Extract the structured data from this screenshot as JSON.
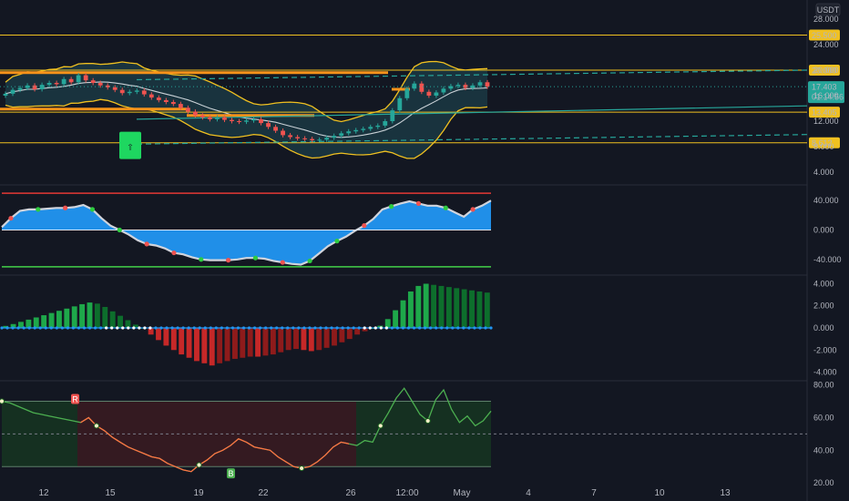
{
  "chart_data": [
    {
      "type": "candlestick",
      "pane": "price",
      "currency": "USDT",
      "y_ticks": [
        "28.000",
        "24.000",
        "20.000",
        "16.000",
        "12.000",
        "8.000",
        "4.000"
      ],
      "ylim": [
        2.0,
        31.0
      ],
      "price_levels": [
        {
          "value": 25.5,
          "label": "25.500",
          "color": "#f0c020"
        },
        {
          "value": 20.0,
          "label": "20.000",
          "color": "#f0c020"
        },
        {
          "value": 13.405,
          "label": "13.405",
          "color": "#f0c020"
        },
        {
          "value": 8.612,
          "label": "8.612",
          "color": "#f0c020"
        }
      ],
      "current_price": {
        "value": 17.403,
        "label": "17.403",
        "countdown": "01:14:56",
        "color": "#26a69a"
      },
      "signal_arrow": {
        "symbol": "⇧",
        "color": "#1ed760"
      },
      "closes": [
        16.3,
        16.9,
        17.2,
        17.6,
        17.0,
        17.7,
        18.0,
        17.8,
        18.6,
        18.1,
        19.2,
        18.4,
        18.0,
        17.6,
        17.3,
        16.9,
        16.4,
        16.6,
        16.8,
        16.2,
        15.7,
        15.3,
        15.0,
        14.7,
        14.1,
        13.5,
        12.9,
        12.6,
        12.3,
        12.6,
        12.2,
        12.0,
        11.9,
        12.1,
        12.3,
        11.7,
        11.1,
        10.5,
        9.8,
        9.5,
        9.3,
        9.2,
        9.0,
        9.1,
        9.4,
        9.7,
        10.1,
        10.4,
        10.6,
        10.8,
        11.1,
        11.3,
        12.0,
        13.7,
        15.6,
        17.1,
        17.9,
        16.6,
        16.0,
        16.5,
        17.1,
        17.5,
        17.7,
        17.2,
        17.6,
        18.1,
        17.4
      ]
    },
    {
      "type": "area",
      "pane": "oscillator",
      "y_ticks": [
        "40.000",
        "0.000",
        "-40.000"
      ],
      "ylim": [
        -60,
        60
      ],
      "upper_line": 50,
      "lower_line": -50,
      "values": [
        4,
        16,
        26,
        28,
        28,
        29,
        30,
        30,
        31,
        34,
        28,
        16,
        6,
        0,
        -6,
        -14,
        -19,
        -21,
        -25,
        -31,
        -33,
        -37,
        -40,
        -41,
        -41,
        -41,
        -40,
        -38,
        -38,
        -39,
        -42,
        -44,
        -46,
        -47,
        -42,
        -32,
        -22,
        -15,
        -9,
        -1,
        6,
        15,
        28,
        32,
        36,
        39,
        36,
        33,
        33,
        30,
        24,
        18,
        28,
        33,
        40
      ]
    },
    {
      "type": "bar",
      "pane": "momentum",
      "y_ticks": [
        "4.000",
        "2.000",
        "0.000",
        "-2.000",
        "-4.000"
      ],
      "ylim": [
        -4.7,
        4.7
      ],
      "values": [
        0.18,
        0.35,
        0.55,
        0.75,
        0.95,
        1.15,
        1.35,
        1.55,
        1.75,
        1.95,
        2.15,
        2.3,
        2.2,
        1.9,
        1.5,
        1.1,
        0.7,
        0.3,
        0.0,
        -0.6,
        -1.1,
        -1.6,
        -2.0,
        -2.4,
        -2.7,
        -3.0,
        -3.2,
        -3.4,
        -3.2,
        -3.0,
        -2.8,
        -2.7,
        -2.6,
        -2.6,
        -2.5,
        -2.4,
        -2.2,
        -2.0,
        -1.9,
        -2.0,
        -2.1,
        -2.0,
        -1.8,
        -1.6,
        -1.3,
        -1.0,
        -0.6,
        -0.3,
        0.0,
        0.2,
        0.8,
        1.6,
        2.5,
        3.3,
        3.8,
        4.0,
        3.9,
        3.8,
        3.7,
        3.6,
        3.5,
        3.4,
        3.3,
        3.2
      ]
    },
    {
      "type": "line",
      "pane": "rsi",
      "y_ticks": [
        "80.00",
        "60.00",
        "40.00",
        "20.00"
      ],
      "ylim": [
        19,
        82
      ],
      "upper_band": 70,
      "lower_band": 30,
      "mid_line": 50,
      "values": [
        70,
        69,
        67,
        65,
        63,
        62,
        61,
        60,
        59,
        58,
        57,
        60,
        55,
        52,
        48,
        45,
        42,
        40,
        38,
        36,
        35,
        32,
        30,
        28,
        27,
        31,
        34,
        38,
        40,
        43,
        47,
        45,
        42,
        41,
        40,
        36,
        33,
        30,
        29,
        30,
        33,
        37,
        42,
        45,
        44,
        43,
        46,
        45,
        55,
        63,
        72,
        78,
        70,
        62,
        58,
        71,
        77,
        65,
        57,
        61,
        55,
        58,
        64
      ],
      "marker_labels": [
        "R",
        "B"
      ]
    }
  ],
  "x_axis": {
    "ticks": [
      "12",
      "15",
      "19",
      "22",
      "26",
      "12:00",
      "May",
      "4",
      "7",
      "10",
      "13"
    ]
  }
}
